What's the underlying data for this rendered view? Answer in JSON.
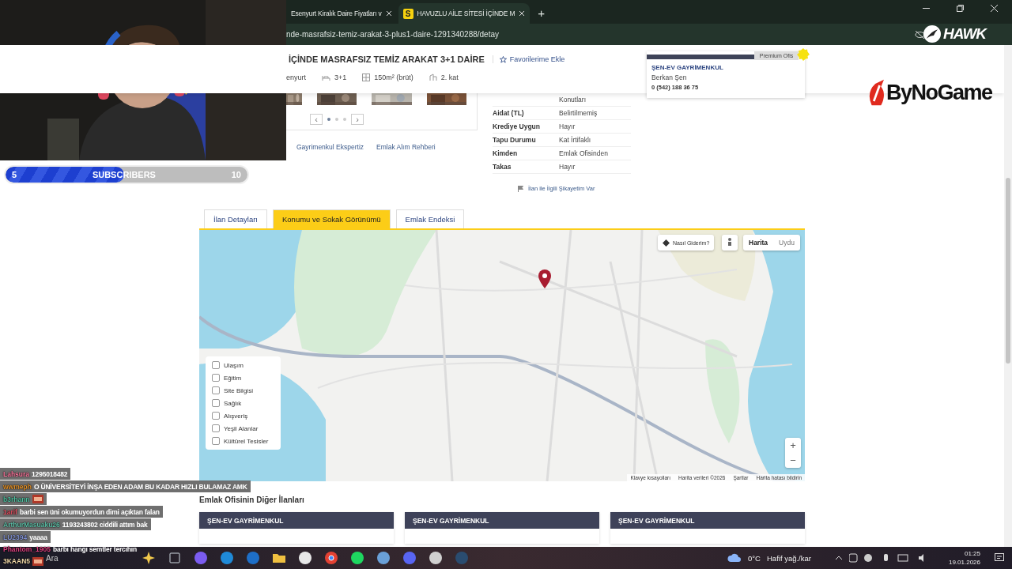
{
  "browser": {
    "tabs": [
      {
        "title": "Esenyurt Kiralık Daire Fiyatları v",
        "selected": false
      },
      {
        "title": "HAVUZLU AİLE SİTESİ İÇİNDE M",
        "favicon": "S",
        "selected": true
      }
    ],
    "new_tab": "+",
    "url": "nde-masrafsiz-temiz-arakat-3-plus1-daire-1291340288/detay"
  },
  "listing": {
    "title": "İÇİNDE MASRAFSIZ TEMİZ ARAKAT 3+1 DAİRE",
    "favorite": "Favorilerime Ekle",
    "facts": [
      {
        "kind": "place",
        "text": "enyurt"
      },
      {
        "kind": "rooms",
        "text": "3+1"
      },
      {
        "kind": "area",
        "text": "150m² (brüt)"
      },
      {
        "kind": "floor",
        "text": "2. kat"
      }
    ]
  },
  "agent": {
    "badge": "Premium Ofis",
    "office": "ŞEN-EV GAYRİMENKUL",
    "name": "Berkan Şen",
    "phone": "0 (542) 188 36 75"
  },
  "gallery": {
    "prev": "‹",
    "next": "›",
    "pages": [
      {
        "selected": true
      },
      {
        "selected": false
      },
      {
        "selected": false
      }
    ]
  },
  "links": [
    "Gayrimenkul Ekspertiz",
    "Emlak Alım Rehberi"
  ],
  "details": {
    "top_value": "Konutları",
    "rows": [
      {
        "label": "Aidat (TL)",
        "value": "Belirtilmemiş"
      },
      {
        "label": "Krediye Uygun",
        "value": "Hayır"
      },
      {
        "label": "Tapu Durumu",
        "value": "Kat İrtifaklı"
      },
      {
        "label": "Kimden",
        "value": "Emlak Ofisinden"
      },
      {
        "label": "Takas",
        "value": "Hayır"
      }
    ],
    "complaint": "İlan ile İlgili Şikayetim Var"
  },
  "tabs": [
    {
      "label": "İlan Detayları",
      "selected": false
    },
    {
      "label": "Konumu ve Sokak Görünümü",
      "selected": true
    },
    {
      "label": "Emlak Endeksi",
      "selected": false
    }
  ],
  "map": {
    "directions": "Nasıl Giderim?",
    "map_types": [
      {
        "label": "Harita",
        "selected": true
      },
      {
        "label": "Uydu",
        "selected": false
      }
    ],
    "zoom_in": "+",
    "zoom_out": "−",
    "layers": [
      {
        "label": "Ulaşım",
        "checked": false
      },
      {
        "label": "Eğitim",
        "checked": false
      },
      {
        "label": "Site Bilgisi",
        "checked": false
      },
      {
        "label": "Sağlık",
        "checked": false
      },
      {
        "label": "Alışveriş",
        "checked": false
      },
      {
        "label": "Yeşil Alanlar",
        "checked": false
      },
      {
        "label": "Kültürel Tesisler",
        "checked": false
      }
    ],
    "footer": [
      "Klavye kısayolları",
      "Harita verileri ©2026",
      "Şartlar",
      "Harita hatası bildirin"
    ]
  },
  "other_listings": {
    "title": "Emlak Ofisinin Diğer İlanları",
    "cards": [
      {
        "office": "ŞEN-EV GAYRİMENKUL"
      },
      {
        "office": "ŞEN-EV GAYRİMENKUL"
      },
      {
        "office": "ŞEN-EV GAYRİMENKUL"
      }
    ]
  },
  "taskbar": {
    "search": "Ara",
    "temperature": "0°C",
    "weather": "Hafif yağ./kar",
    "time": "01:25",
    "date": "19.01.2026"
  },
  "stream": {
    "subscribers": {
      "current": "5",
      "label": "SUBSCRIBERS",
      "goal": "10",
      "level": 0.49
    },
    "logos": [
      "HAWK",
      "ByNoGame"
    ],
    "chat": [
      {
        "user": "Lahsura",
        "color": "#ff7aa0",
        "kind": "text",
        "text": "1295018482"
      },
      {
        "user": "wwmeph",
        "color": "#e0902a",
        "kind": "text",
        "text": "O ÜNİVERSİTEYİ İNŞA EDEN ADAM BU KADAR HIZLI BULAMAZ AMK"
      },
      {
        "user": "b3rhann",
        "color": "#4fc0a0",
        "kind": "emote"
      },
      {
        "user": "1arif",
        "color": "#e05060",
        "kind": "text",
        "text": "barbi sen üni okumuyordun dimi açıktan falan"
      },
      {
        "user": "ArthurMasuaku26",
        "color": "#5fc0a8",
        "kind": "text",
        "text": "1193243802 ciddili attım bak"
      },
      {
        "user": "LU2394",
        "color": "#8090d0",
        "kind": "text",
        "text": "yaaaa"
      },
      {
        "user": "Phantom_1905",
        "color": "#e04080",
        "kind": "text",
        "text": "barbi hangi semtler tercihin"
      },
      {
        "user": "3KAAN5",
        "color": "#f0d8a8",
        "kind": "emote"
      }
    ]
  }
}
